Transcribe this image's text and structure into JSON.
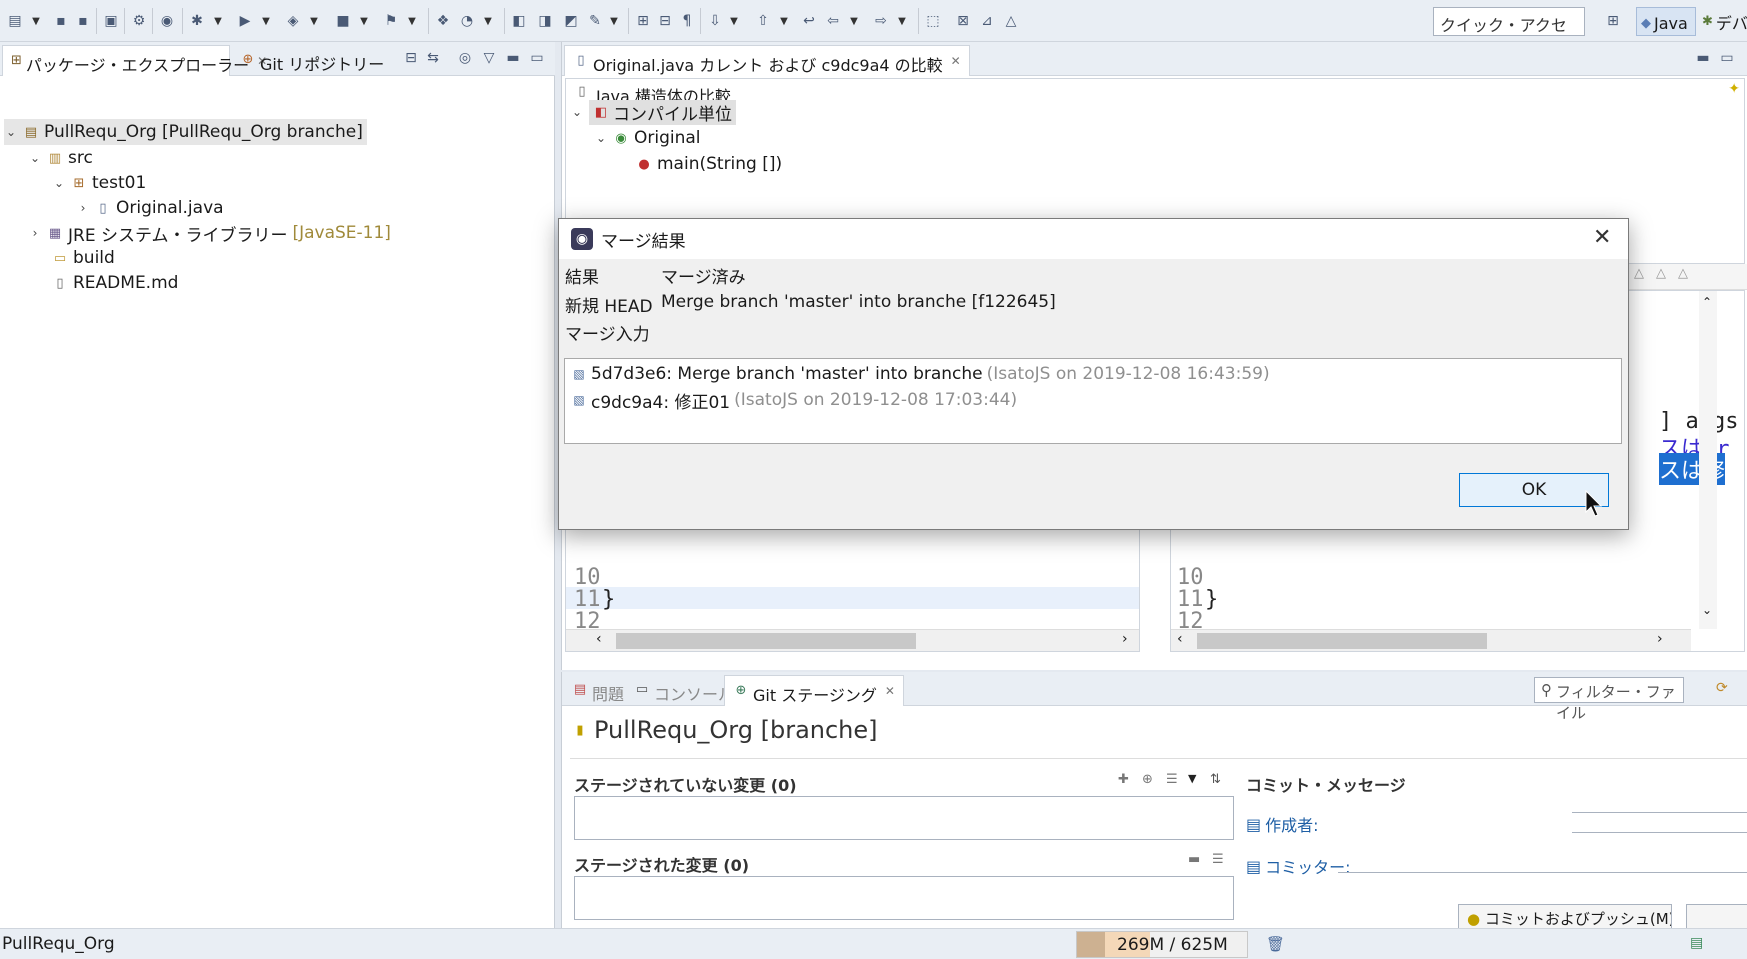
{
  "toolbar": {
    "quick_access_placeholder": "クイック・アクセス",
    "perspective_java": "Java",
    "perspective_debug": "デバ"
  },
  "left_view": {
    "tabs": [
      {
        "label": "パッケージ・エクスプローラー"
      },
      {
        "label": "Git リポジトリー"
      }
    ],
    "tree": [
      {
        "label": "PullRequ_Org [PullRequ_Org branche]",
        "level": 0,
        "expanded": true
      },
      {
        "label": "src",
        "level": 1,
        "expanded": true
      },
      {
        "label": "test01",
        "level": 2,
        "expanded": true
      },
      {
        "label": "Original.java",
        "level": 3,
        "expanded": false
      },
      {
        "label": "JRE システム・ライブラリー",
        "suffix": "[JavaSE-11]",
        "level": 1,
        "expanded": false
      },
      {
        "label": "build",
        "level": 1
      },
      {
        "label": "README.md",
        "level": 1
      }
    ]
  },
  "editor": {
    "tab_label": "Original.java カレント および c9dc9a4 の比較",
    "structure_title": "Java 構造体の比較",
    "structure_tree": [
      {
        "label": "コンパイル単位",
        "level": 0
      },
      {
        "label": "Original",
        "level": 1
      },
      {
        "label": "main(String [])",
        "level": 2
      }
    ],
    "left_code": {
      "line10": "10",
      "line11": "11",
      "line11_text": "}",
      "line12": "12"
    },
    "right_code": {
      "line10": "10",
      "line11": "11",
      "line11_text": "}",
      "line12": "12",
      "peek1": "] args",
      "peek2": "スは0r",
      "peek3": "スは修"
    }
  },
  "bottom_view": {
    "tabs": [
      {
        "label": "問題"
      },
      {
        "label": "コンソール"
      },
      {
        "label": "Git ステージング"
      }
    ],
    "filter_placeholder": "フィルター・ファイル",
    "repo_title": "PullRequ_Org [branche]",
    "unstaged_title": "ステージされていない変更 (0)",
    "staged_title": "ステージされた変更 (0)",
    "commit_message_title": "コミット・メッセージ",
    "author_label": "作成者:",
    "committer_label": "コミッター:",
    "commit_push_button": "コミットおよびプッシュ(M)"
  },
  "status_bar": {
    "left_text": "PullRequ_Org",
    "memory": "269M / 625M",
    "heap_fill": 0.43
  },
  "dialog": {
    "title": "マージ結果",
    "result_label": "結果",
    "result_value": "マージ済み",
    "new_head_label": "新規 HEAD",
    "new_head_value": "Merge branch 'master' into branche [f122645]",
    "merge_input_label": "マージ入力",
    "merge_inputs": [
      {
        "commit": "5d7d3e6: Merge branch 'master' into branche",
        "meta": "(IsatoJS on 2019-12-08 16:43:59)"
      },
      {
        "commit": "c9dc9a4: 修正01",
        "meta": "(IsatoJS on 2019-12-08 17:03:44)"
      }
    ],
    "ok_label": "OK"
  },
  "colors": {
    "accent": "#0078d7",
    "ide_background": "#e9eef4",
    "selection": "#cfe3f7"
  }
}
